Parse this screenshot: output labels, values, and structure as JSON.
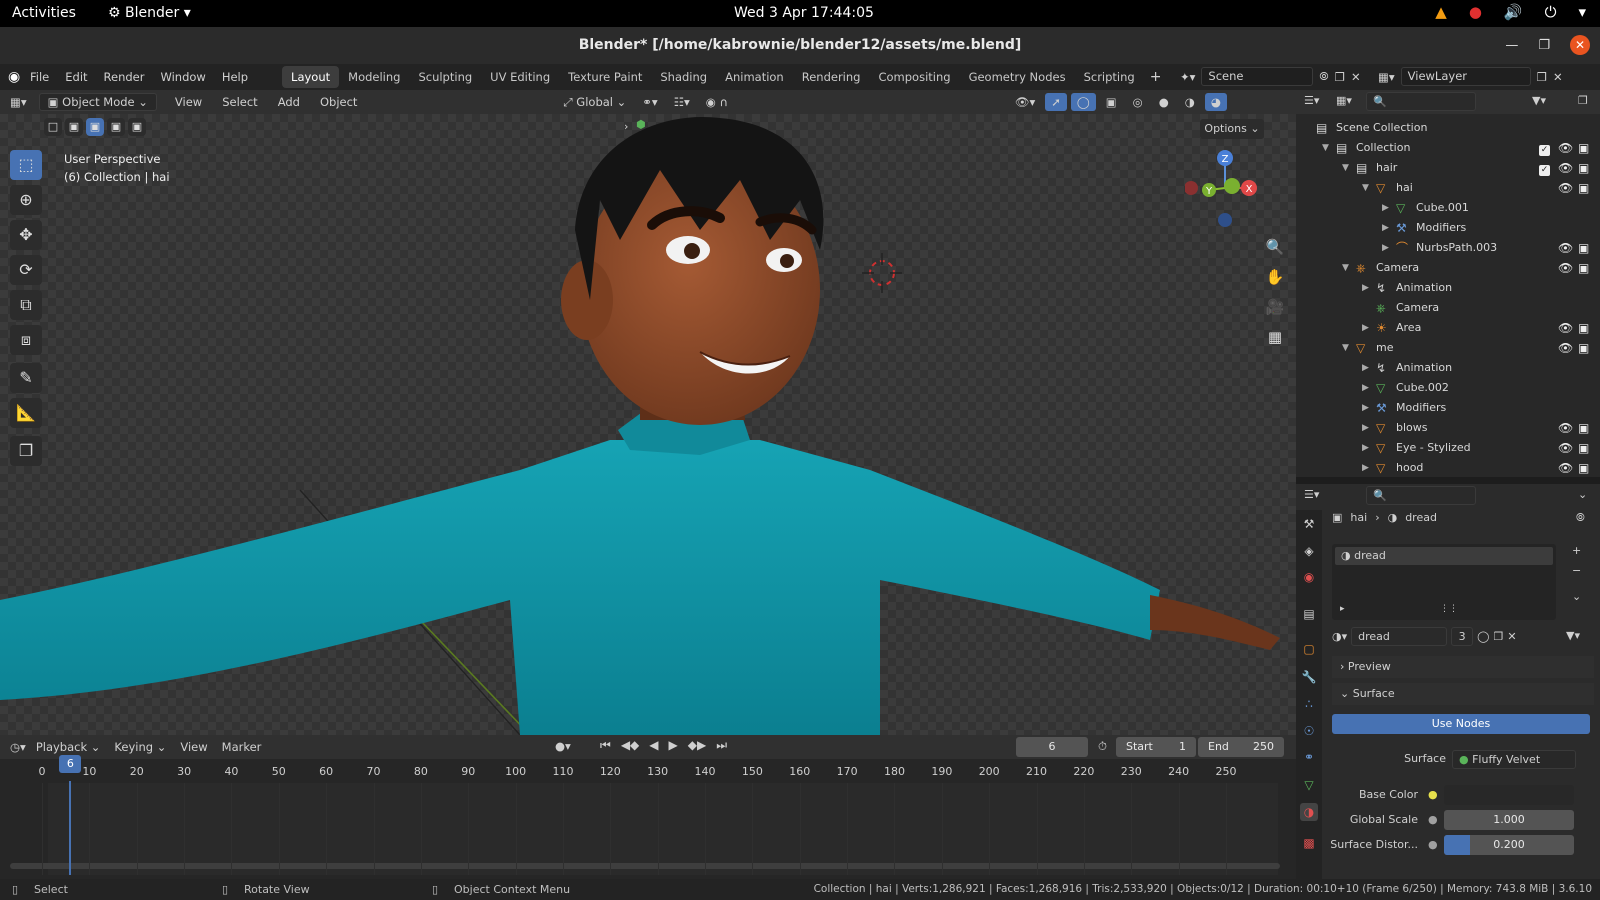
{
  "system_bar": {
    "activities": "Activities",
    "app_name": "Blender",
    "clock": "Wed 3 Apr  17:44:05"
  },
  "window": {
    "title": "Blender* [/home/kabrownie/blender12/assets/me.blend]"
  },
  "menu": [
    "File",
    "Edit",
    "Render",
    "Window",
    "Help"
  ],
  "workspaces": [
    "Layout",
    "Modeling",
    "Sculpting",
    "UV Editing",
    "Texture Paint",
    "Shading",
    "Animation",
    "Rendering",
    "Compositing",
    "Geometry Nodes",
    "Scripting"
  ],
  "active_workspace": "Layout",
  "scene": {
    "name": "Scene",
    "view_layer": "ViewLayer"
  },
  "viewport_header": {
    "mode": "Object Mode",
    "menus": [
      "View",
      "Select",
      "Add",
      "Object"
    ],
    "orientation": "Global",
    "options": "Options"
  },
  "viewport": {
    "perspective": "User Perspective",
    "collection_info": "(6) Collection | hai",
    "gizmo_axes": {
      "z": "Z",
      "y": "Y",
      "x": "X"
    }
  },
  "outliner": {
    "rows": [
      {
        "label": "Scene Collection",
        "indent": 0,
        "icon": "scene-collection-icon"
      },
      {
        "label": "Collection",
        "indent": 1,
        "icon": "collection-icon"
      },
      {
        "label": "hair",
        "indent": 2,
        "icon": "collection-icon"
      },
      {
        "label": "hai",
        "indent": 3,
        "icon": "mesh-object-icon"
      },
      {
        "label": "Cube.001",
        "indent": 4,
        "icon": "mesh-data-icon"
      },
      {
        "label": "Modifiers",
        "indent": 4,
        "icon": "wrench-icon"
      },
      {
        "label": "NurbsPath.003",
        "indent": 4,
        "icon": "curve-icon"
      },
      {
        "label": "Camera",
        "indent": 2,
        "icon": "camera-object-icon"
      },
      {
        "label": "Animation",
        "indent": 3,
        "icon": "animation-icon"
      },
      {
        "label": "Camera",
        "indent": 3,
        "icon": "camera-data-icon"
      },
      {
        "label": "Area",
        "indent": 3,
        "icon": "light-icon"
      },
      {
        "label": "me",
        "indent": 2,
        "icon": "mesh-object-icon"
      },
      {
        "label": "Animation",
        "indent": 3,
        "icon": "animation-icon"
      },
      {
        "label": "Cube.002",
        "indent": 3,
        "icon": "mesh-data-icon"
      },
      {
        "label": "Modifiers",
        "indent": 3,
        "icon": "wrench-icon"
      },
      {
        "label": "blows",
        "indent": 3,
        "icon": "mesh-object-icon"
      },
      {
        "label": "Eye - Stylized",
        "indent": 3,
        "icon": "mesh-object-icon"
      },
      {
        "label": "hood",
        "indent": 3,
        "icon": "mesh-object-icon"
      }
    ]
  },
  "properties": {
    "breadcrumb_object": "hai",
    "breadcrumb_material": "dread",
    "slot_name": "dread",
    "material_name": "dread",
    "user_count": "3",
    "preview_label": "Preview",
    "surface_section": "Surface",
    "use_nodes": "Use Nodes",
    "surface_label": "Surface",
    "surface_value": "Fluffy Velvet",
    "base_color_label": "Base Color",
    "global_scale_label": "Global Scale",
    "global_scale_value": "1.000",
    "surface_distortion_label": "Surface Distor...",
    "surface_distortion_value": "0.200",
    "surface_distortion_fraction": 0.2
  },
  "timeline": {
    "menus": [
      "Playback",
      "Keying",
      "View",
      "Marker"
    ],
    "current_frame": "6",
    "start_label": "Start",
    "start": "1",
    "end_label": "End",
    "end": "250",
    "ticks": [
      "0",
      "10",
      "20",
      "30",
      "40",
      "50",
      "60",
      "70",
      "80",
      "90",
      "100",
      "110",
      "120",
      "130",
      "140",
      "150",
      "160",
      "170",
      "180",
      "190",
      "200",
      "210",
      "220",
      "230",
      "240",
      "250"
    ],
    "playhead_label": "6"
  },
  "statusbar": {
    "select": "Select",
    "rotate": "Rotate View",
    "context": "Object Context Menu",
    "stats": "Collection | hai | Verts:1,286,921 | Faces:1,268,916 | Tris:2,533,920 | Objects:0/12 | Duration: 00:10+10 (Frame 6/250) | Memory: 743.8 MiB | 3.6.10"
  },
  "colors": {
    "accent": "#4772b3",
    "sweater": "#0f8fa0",
    "skin": "#8a4a2a",
    "hair": "#141414"
  }
}
